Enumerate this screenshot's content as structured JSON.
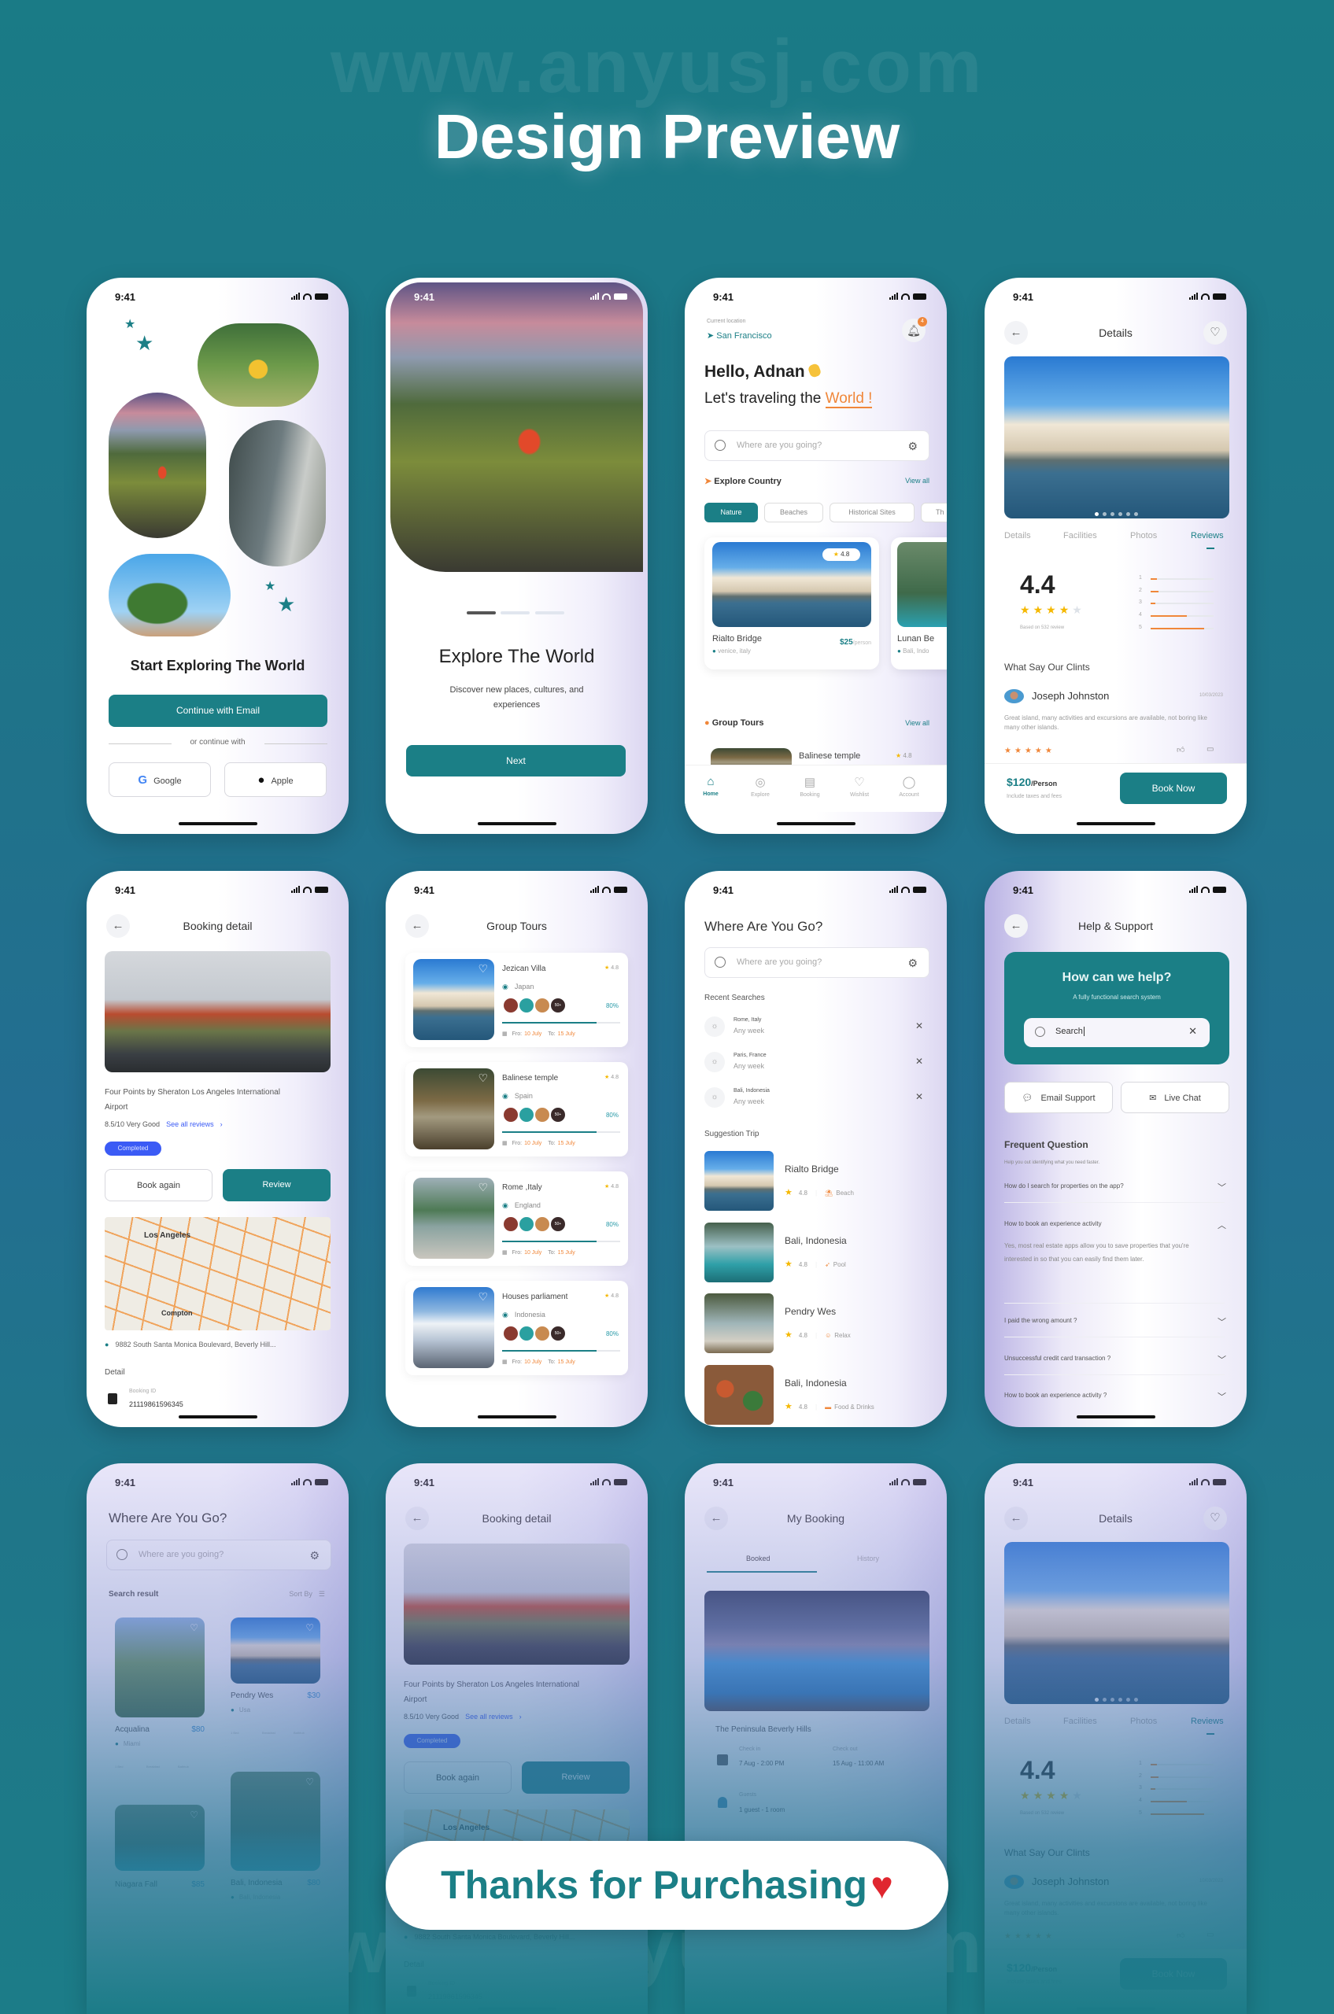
{
  "page": {
    "title": "Design Preview",
    "footer_pill": "Thanks for Purchasing",
    "watermark": "www.anyusj.com"
  },
  "colors": {
    "primary": "#1b7f86",
    "accent": "#f0873a",
    "completed_badge": "#3b5bf5",
    "heart": "#e0262f",
    "star": "#f5b800"
  },
  "status_bar": {
    "time": "9:41"
  },
  "onboarding_start": {
    "title": "Start Exploring The World",
    "email_button": "Continue with Email",
    "divider": "or continue with",
    "google_button": "Google",
    "apple_button": "Apple"
  },
  "onboarding_explore": {
    "title": "Explore The World",
    "subtitle": "Discover new places, cultures, and experiences",
    "next_button": "Next",
    "page_indicator": {
      "current": 1,
      "total": 3
    }
  },
  "home": {
    "current_location_label": "Current location",
    "location": "San Francisco",
    "notification_count": "4",
    "greeting": "Hello, Adnan",
    "tagline_prefix": "Let's traveling the",
    "tagline_highlight": "World !",
    "search_placeholder": "Where are you going?",
    "explore_title": "Explore Country",
    "view_all": "View all",
    "chips": [
      "Nature",
      "Beaches",
      "Historical Sites",
      "Th"
    ],
    "active_chip": "Nature",
    "cards": [
      {
        "name": "Rialto Bridge",
        "location": "venice, italy",
        "price": "$25",
        "price_unit": "/person",
        "rating": "4.8"
      },
      {
        "name": "Lunan Be",
        "location": "Bali, Indo"
      }
    ],
    "group_tours_title": "Group Tours",
    "group_tour_preview": {
      "name": "Balinese temple",
      "rating": "4.8"
    },
    "tabs": [
      "Home",
      "Explore",
      "Booking",
      "Wishlist",
      "Account"
    ],
    "active_tab": "Home"
  },
  "details": {
    "title": "Details",
    "tabs": [
      "Details",
      "Facilities",
      "Photos",
      "Reviews"
    ],
    "active_tab": "Reviews",
    "rating": "4.4",
    "rating_stars": 4,
    "review_basis": "Based on 532 review",
    "distribution": [
      {
        "label": "1",
        "fraction": 0.1
      },
      {
        "label": "2",
        "fraction": 0.12
      },
      {
        "label": "3",
        "fraction": 0.07
      },
      {
        "label": "4",
        "fraction": 0.58
      },
      {
        "label": "5",
        "fraction": 0.85
      }
    ],
    "reviews_title": "What Say Our Clints",
    "review": {
      "name": "Joseph Johnston",
      "date": "10/03/2023",
      "text": "Great island, many activities and excursions are available, not boring like many other islands.",
      "stars": 5
    },
    "price": "$120",
    "price_unit": "/Person",
    "price_note": "Include taxes and fees",
    "book_button": "Book Now"
  },
  "booking_detail": {
    "title": "Booking detail",
    "hotel_name": "Four Points by Sheraton Los Angeles International Airport",
    "score": "8.5/10 Very Good",
    "see_reviews": "See all reviews",
    "status": "Completed",
    "book_again": "Book again",
    "review_button": "Review",
    "map_labels": [
      "Los Angeles",
      "Compton"
    ],
    "address": "9882 South Santa Monica Boulevard, Beverly Hill...",
    "detail_title": "Detail",
    "booking_id_label": "Booking ID",
    "booking_id": "21119861596345"
  },
  "group_tours": {
    "title": "Group Tours",
    "from_label": "Fro:",
    "to_label": "To:",
    "tours": [
      {
        "name": "Jezican Villa",
        "location": "Japan",
        "rating": "4.8",
        "participants_extra": "50+",
        "progress": "80%",
        "from": "10 July",
        "to": "15 July"
      },
      {
        "name": "Balinese temple",
        "location": "Spain",
        "rating": "4.8",
        "participants_extra": "50+",
        "progress": "80%",
        "from": "10 July",
        "to": "15 July"
      },
      {
        "name": "Rome ,Italy",
        "location": "England",
        "rating": "4.8",
        "participants_extra": "50+",
        "progress": "80%",
        "from": "10 July",
        "to": "15 July"
      },
      {
        "name": "Houses parliament",
        "location": "Indonesia",
        "rating": "4.8",
        "participants_extra": "50+",
        "progress": "80%",
        "from": "10 July",
        "to": "15 July"
      }
    ]
  },
  "where_search": {
    "title": "Where Are You Go?",
    "search_placeholder": "Where are you going?",
    "recent_title": "Recent Searches",
    "recent": [
      {
        "place": "Rome, Italy",
        "when": "Any week"
      },
      {
        "place": "Paris, France",
        "when": "Any week"
      },
      {
        "place": "Bali, Indonesia",
        "when": "Any week"
      }
    ],
    "suggestion_title": "Suggestion Trip",
    "suggestions": [
      {
        "name": "Rialto Bridge",
        "rating": "4.8",
        "tag": "Beach"
      },
      {
        "name": "Bali, Indonesia",
        "rating": "4.8",
        "tag": "Pool"
      },
      {
        "name": "Pendry Wes",
        "rating": "4.8",
        "tag": "Relax"
      },
      {
        "name": "Bali, Indonesia",
        "rating": "4.8",
        "tag": "Food & Drinks"
      }
    ]
  },
  "help": {
    "title": "Help & Support",
    "hero_title": "How can we help?",
    "hero_subtitle": "A fully functional search system",
    "search_value": "Search",
    "email_support": "Email Support",
    "live_chat": "Live Chat",
    "faq_title": "Frequent Question",
    "faq_subtitle": "Help you out identifying what you need faster.",
    "faqs": [
      {
        "q": "How do I search for properties on the app?",
        "open": false
      },
      {
        "q": "How to book an experience activity",
        "open": true,
        "a": "Yes, most real estate apps allow you to save properties that you're interested in so that you can easily find them later."
      },
      {
        "q": "I paid the wrong amount ?",
        "open": false
      },
      {
        "q": "Unsuccessful credit card transaction ?",
        "open": false
      },
      {
        "q": "How to book an experience activity ?",
        "open": false
      }
    ]
  },
  "search_results": {
    "title": "Where Are You Go?",
    "search_placeholder": "Where are you going?",
    "results_title": "Search result",
    "sort_by": "Sort By",
    "amenities": [
      "1 Bed",
      "Breakfast",
      "Bathtub"
    ],
    "results": [
      {
        "name": "Acqualina",
        "price": "$80",
        "location": "Miami"
      },
      {
        "name": "Pendry Wes",
        "price": "$30",
        "location": "Usa"
      },
      {
        "name": "Niagara Fall",
        "price": "$85"
      },
      {
        "name": "Bali, Indonesia",
        "price": "$80",
        "location": "Bali, Indonesia"
      }
    ]
  },
  "my_booking": {
    "title": "My Booking",
    "tabs": [
      "Booked",
      "History"
    ],
    "active_tab": "Booked",
    "hotel": "The Peninsula Beverly Hills",
    "check_in_label": "Check in",
    "check_in": "7 Aug - 2:00 PM",
    "check_out_label": "Check out",
    "check_out": "15 Aug - 11:00 AM",
    "guests_label": "Guests",
    "guests": "1 guest - 1 room"
  }
}
